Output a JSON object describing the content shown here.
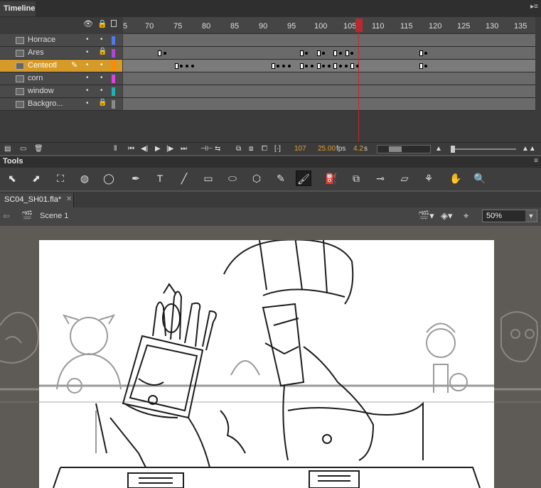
{
  "timeline": {
    "tab_label": "Timeline",
    "ruler_numbers": [
      "5",
      "70",
      "75",
      "80",
      "85",
      "90",
      "95",
      "100",
      "105",
      "110",
      "115",
      "120",
      "125",
      "130",
      "135"
    ],
    "layers": [
      {
        "name": "Horrace",
        "color": "#4d7ce8",
        "locked": false,
        "selected": false
      },
      {
        "name": "Ares",
        "color": "#b046d6",
        "locked": true,
        "selected": false
      },
      {
        "name": "Centeotl",
        "color": "#ff8a00",
        "locked": false,
        "selected": true
      },
      {
        "name": "corn",
        "color": "#e040e0",
        "locked": false,
        "selected": false
      },
      {
        "name": "window",
        "color": "#1fb3b0",
        "locked": false,
        "selected": false
      },
      {
        "name": "Backgro...",
        "color": "#8a8a8a",
        "locked": true,
        "selected": false
      }
    ],
    "current_frame": "107",
    "fps_value": "25.00",
    "fps_unit": "fps",
    "time_value": "4.2",
    "time_unit": "s"
  },
  "tools": {
    "tab_label": "Tools",
    "items": [
      "selection-tool",
      "subselection-tool",
      "free-transform-tool",
      "3d-rotation-tool",
      "lasso-tool",
      "pen-tool",
      "text-tool",
      "line-tool",
      "rectangle-tool",
      "oval-tool",
      "polystar-tool",
      "pencil-tool",
      "brush-tool",
      "paint-bucket-tool",
      "ink-bottle-tool",
      "eyedropper-tool",
      "eraser-tool",
      "bone-tool",
      "hand-tool",
      "zoom-tool"
    ],
    "glyphs": [
      "⬉",
      "⬈",
      "⛶",
      "◍",
      "◯",
      "✒",
      "T",
      "╱",
      "▭",
      "⬭",
      "⬡",
      "✎",
      "🖌",
      "⛽",
      "⧉",
      "⊸",
      "▱",
      "⚘",
      "✋",
      "🔍"
    ],
    "active": "brush-tool"
  },
  "document": {
    "tab_label": "SC04_SH01.fla*",
    "scene_label": "Scene 1",
    "zoom_value": "50%"
  }
}
